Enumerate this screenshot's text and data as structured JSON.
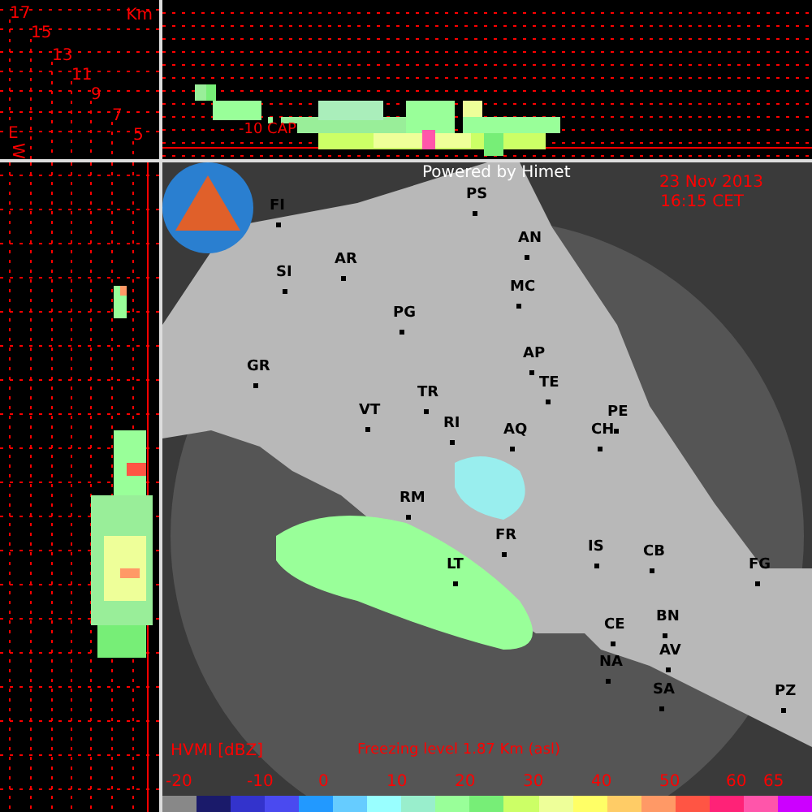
{
  "altitude_panel": {
    "unit": "Km",
    "ticks": [
      "17",
      "15",
      "13",
      "11",
      "9",
      "7",
      "5"
    ],
    "axis_letters": [
      "E",
      "W"
    ]
  },
  "top_profile": {
    "label": "-10 CAP"
  },
  "map": {
    "credit": "Powered by Himet",
    "date": "23 Nov 2013",
    "time": "16:15 CET",
    "cities": [
      {
        "label": "FI"
      },
      {
        "label": "SI"
      },
      {
        "label": "AR"
      },
      {
        "label": "PG"
      },
      {
        "label": "GR"
      },
      {
        "label": "TR"
      },
      {
        "label": "VT"
      },
      {
        "label": "RI"
      },
      {
        "label": "AQ"
      },
      {
        "label": "RM"
      },
      {
        "label": "FR"
      },
      {
        "label": "LT"
      },
      {
        "label": "PS"
      },
      {
        "label": "AN"
      },
      {
        "label": "MC"
      },
      {
        "label": "AP"
      },
      {
        "label": "TE"
      },
      {
        "label": "PE"
      },
      {
        "label": "CH"
      },
      {
        "label": "IS"
      },
      {
        "label": "CB"
      },
      {
        "label": "FG"
      },
      {
        "label": "CE"
      },
      {
        "label": "BN"
      },
      {
        "label": "NA"
      },
      {
        "label": "AV"
      },
      {
        "label": "SA"
      },
      {
        "label": "PZ"
      }
    ]
  },
  "legend": {
    "title": "HVMI [dBZ]",
    "freezing_level": "Freezing level  1.87 Km (asl)",
    "scale_labels": [
      "-20",
      "-10",
      "0",
      "10",
      "20",
      "30",
      "40",
      "50",
      "60",
      "65"
    ],
    "colors": [
      {
        "color": "#888888"
      },
      {
        "color": "#1a1a6a"
      },
      {
        "color": "#3333cc"
      },
      {
        "color": "#4a4af0"
      },
      {
        "color": "#2299ff"
      },
      {
        "color": "#66ccff"
      },
      {
        "color": "#99ffff"
      },
      {
        "color": "#99eecc"
      },
      {
        "color": "#99ff99"
      },
      {
        "color": "#77ee77"
      },
      {
        "color": "#ccff66"
      },
      {
        "color": "#eeff99"
      },
      {
        "color": "#ffff66"
      },
      {
        "color": "#ffcc66"
      },
      {
        "color": "#ff9966"
      },
      {
        "color": "#ff5544"
      },
      {
        "color": "#ff2277"
      },
      {
        "color": "#ff55aa"
      },
      {
        "color": "#cc00ff"
      }
    ]
  }
}
